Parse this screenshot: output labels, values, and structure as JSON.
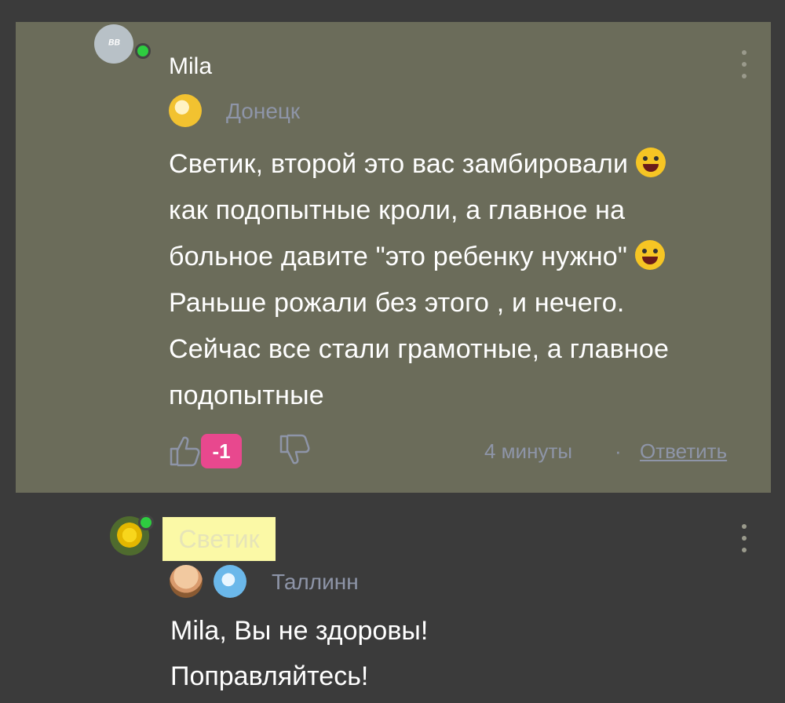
{
  "comments": [
    {
      "author": "Mila",
      "avatar_text": "ᴮᴮ",
      "city": "Донецк",
      "lines": [
        "Светик, второй это вас замбировали",
        "как подопытные кроли, а главное на",
        "больное давите \"это ребенку нужно\"",
        "Раньше рожали без этого , и нечего.",
        "Сейчас все стали грамотные, а главное",
        "подопытные"
      ],
      "score": "-1",
      "time": "4 минуты",
      "separator": "·",
      "reply_label": "Ответить"
    },
    {
      "author": "Светик",
      "city": "Таллинн",
      "lines": [
        "Mila, Вы не здоровы!",
        "Поправляйтесь!"
      ]
    }
  ],
  "colors": {
    "highlight_bg": "#6b6c5a",
    "score_badge": "#e8488e",
    "online": "#2ecc40",
    "meta_text": "#8e95a8"
  }
}
